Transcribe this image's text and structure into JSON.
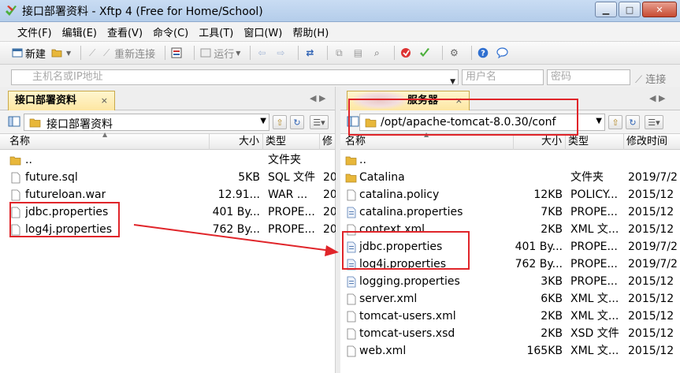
{
  "window": {
    "title": "接口部署资料 - Xftp 4 (Free for Home/School)",
    "minimize": "▁",
    "maximize": "□",
    "close": "✕"
  },
  "menu": [
    "文件(F)",
    "编辑(E)",
    "查看(V)",
    "命令(C)",
    "工具(T)",
    "窗口(W)",
    "帮助(H)"
  ],
  "toolbar": {
    "new_label": "新建",
    "reconnect_label": "重新连接",
    "run_label": "运行"
  },
  "address": {
    "host_placeholder": "主机名或IP地址",
    "user_placeholder": "用户名",
    "password_placeholder": "密码",
    "connect_label": "连接"
  },
  "left_pane": {
    "tab_label": "接口部署资料",
    "tab_close": "×",
    "nav": "◀ ▶",
    "path": "接口部署资料",
    "columns": {
      "name": "名称",
      "size": "大小",
      "type": "类型",
      "modified": "修"
    },
    "files": [
      {
        "name": "..",
        "size": "",
        "type": "文件夹",
        "modified": "",
        "icon": "folder-icon"
      },
      {
        "name": "future.sql",
        "size": "5KB",
        "type": "SQL 文件",
        "modified": "20",
        "icon": "file-icon"
      },
      {
        "name": "futureloan.war",
        "size": "12.91...",
        "type": "WAR ...",
        "modified": "20",
        "icon": "file-icon"
      },
      {
        "name": "jdbc.properties",
        "size": "401 By...",
        "type": "PROPE...",
        "modified": "20",
        "icon": "file-icon"
      },
      {
        "name": "log4j.properties",
        "size": "762 By...",
        "type": "PROPE...",
        "modified": "20",
        "icon": "file-icon"
      }
    ]
  },
  "right_pane": {
    "tab_label": "服务器",
    "tab_close": "×",
    "nav": "◀ ▶",
    "path": "/opt/apache-tomcat-8.0.30/conf",
    "columns": {
      "name": "名称",
      "size": "大小",
      "type": "类型",
      "modified": "修改时间"
    },
    "files": [
      {
        "name": "..",
        "size": "",
        "type": "",
        "modified": "",
        "icon": "folder-icon"
      },
      {
        "name": "Catalina",
        "size": "",
        "type": "文件夹",
        "modified": "2019/7/2",
        "icon": "folder-icon"
      },
      {
        "name": "catalina.policy",
        "size": "12KB",
        "type": "POLICY...",
        "modified": "2015/12",
        "icon": "file-icon"
      },
      {
        "name": "catalina.properties",
        "size": "7KB",
        "type": "PROPE...",
        "modified": "2015/12",
        "icon": "file-icon"
      },
      {
        "name": "context.xml",
        "size": "2KB",
        "type": "XML 文...",
        "modified": "2015/12",
        "icon": "file-icon"
      },
      {
        "name": "jdbc.properties",
        "size": "401 By...",
        "type": "PROPE...",
        "modified": "2019/7/2",
        "icon": "file-icon"
      },
      {
        "name": "log4j.properties",
        "size": "762 By...",
        "type": "PROPE...",
        "modified": "2019/7/2",
        "icon": "file-icon"
      },
      {
        "name": "logging.properties",
        "size": "3KB",
        "type": "PROPE...",
        "modified": "2015/12",
        "icon": "file-icon"
      },
      {
        "name": "server.xml",
        "size": "6KB",
        "type": "XML 文...",
        "modified": "2015/12",
        "icon": "file-icon"
      },
      {
        "name": "tomcat-users.xml",
        "size": "2KB",
        "type": "XML 文...",
        "modified": "2015/12",
        "icon": "file-icon"
      },
      {
        "name": "tomcat-users.xsd",
        "size": "2KB",
        "type": "XSD 文件",
        "modified": "2015/12",
        "icon": "file-icon"
      },
      {
        "name": "web.xml",
        "size": "165KB",
        "type": "XML 文...",
        "modified": "2015/12",
        "icon": "file-icon"
      }
    ]
  },
  "colors": {
    "annotation_red": "#e0252a",
    "folder_yellow": "#e8b73a",
    "tab_yellow": "#fde6a2"
  }
}
